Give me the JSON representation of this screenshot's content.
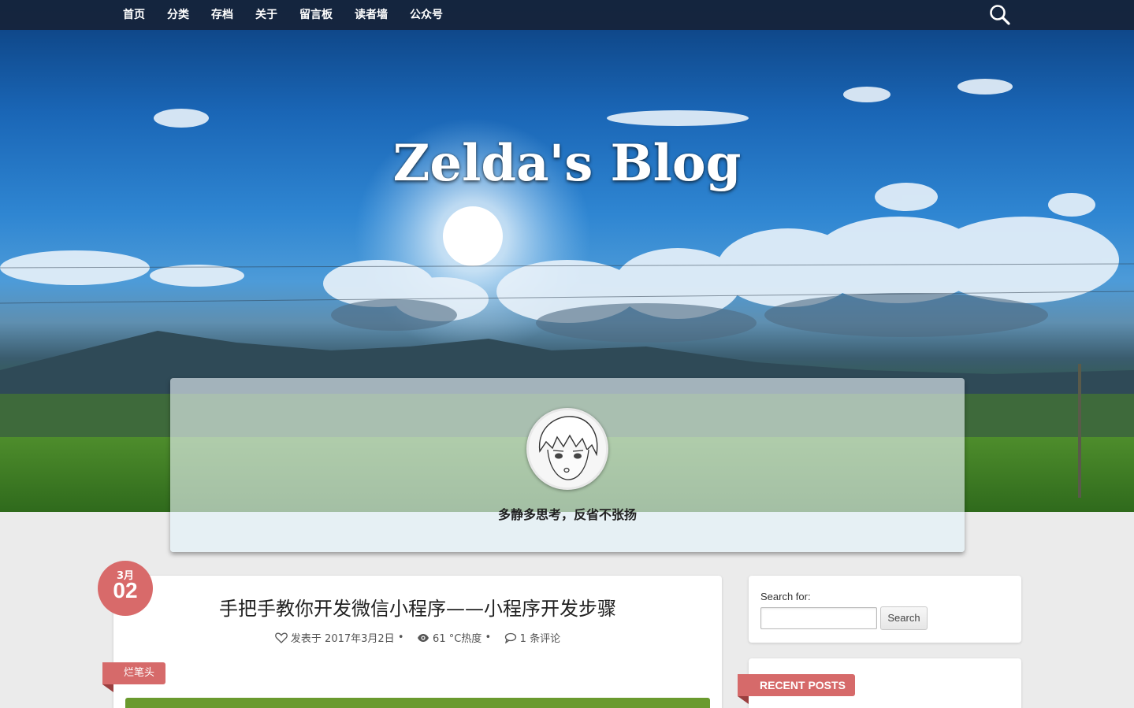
{
  "nav": {
    "items": [
      {
        "label": "首页"
      },
      {
        "label": "分类"
      },
      {
        "label": "存档"
      },
      {
        "label": "关于"
      },
      {
        "label": "留言板"
      },
      {
        "label": "读者墙"
      },
      {
        "label": "公众号"
      }
    ],
    "search_icon": "search-icon"
  },
  "site": {
    "title": "Zelda's Blog",
    "motto": "多静多思考，反省不张扬"
  },
  "post": {
    "date_month": "3月",
    "date_day": "02",
    "title": "手把手教你开发微信小程序——小程序开发步骤",
    "meta": {
      "date_text": "发表于 2017年3月2日",
      "views_text": "61 °C热度",
      "comments_text": "1 条评论"
    },
    "category": "烂笔头"
  },
  "sidebar": {
    "search": {
      "label": "Search for:",
      "placeholder": "",
      "button": "Search"
    },
    "recent_title": "RECENT POSTS"
  },
  "colors": {
    "nav_bg": "#162338",
    "accent_red": "#d66a6a",
    "featured_green": "#6a9a2e"
  }
}
